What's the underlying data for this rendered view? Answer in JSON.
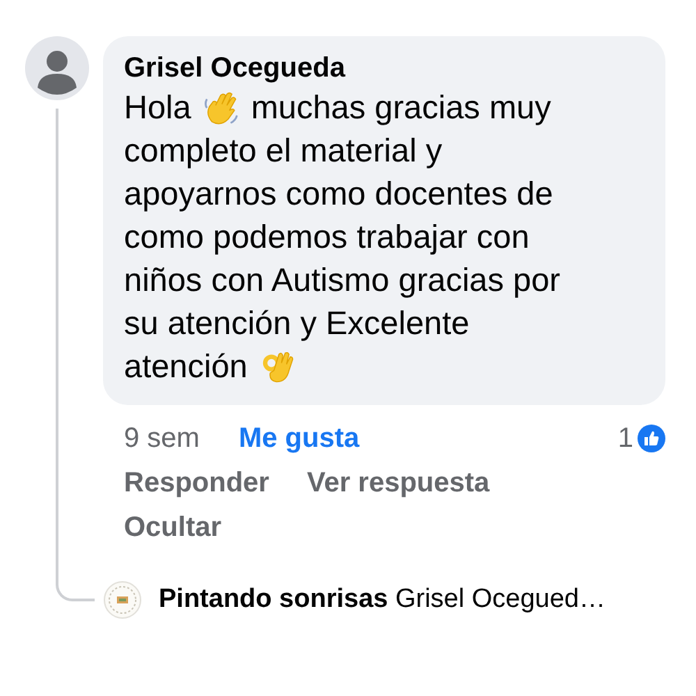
{
  "comment": {
    "author": "Grisel Ocegueda",
    "body_lines": [
      [
        {
          "kind": "text",
          "text": "Hola"
        },
        {
          "kind": "wave-emoji"
        },
        {
          "kind": "text",
          "text": "muchas gracias muy"
        }
      ],
      [
        {
          "kind": "text",
          "text": "completo el material y"
        }
      ],
      [
        {
          "kind": "text",
          "text": "apoyarnos como docentes de"
        }
      ],
      [
        {
          "kind": "text",
          "text": "como podemos trabajar con"
        }
      ],
      [
        {
          "kind": "text",
          "text": "niños con Autismo gracias por"
        }
      ],
      [
        {
          "kind": "text",
          "text": "su atención y Excelente"
        }
      ],
      [
        {
          "kind": "text",
          "text": "atención"
        },
        {
          "kind": "ok-emoji"
        }
      ]
    ],
    "time": "9 sem",
    "like_action": {
      "label": "Me gusta",
      "selected": true
    },
    "reaction_count": "1",
    "actions": [
      "Responder",
      "Ver respuesta"
    ],
    "hide": "Ocultar"
  },
  "reply_preview": {
    "author": "Pintando sonrisas",
    "text": "Grisel Ocegued…"
  }
}
